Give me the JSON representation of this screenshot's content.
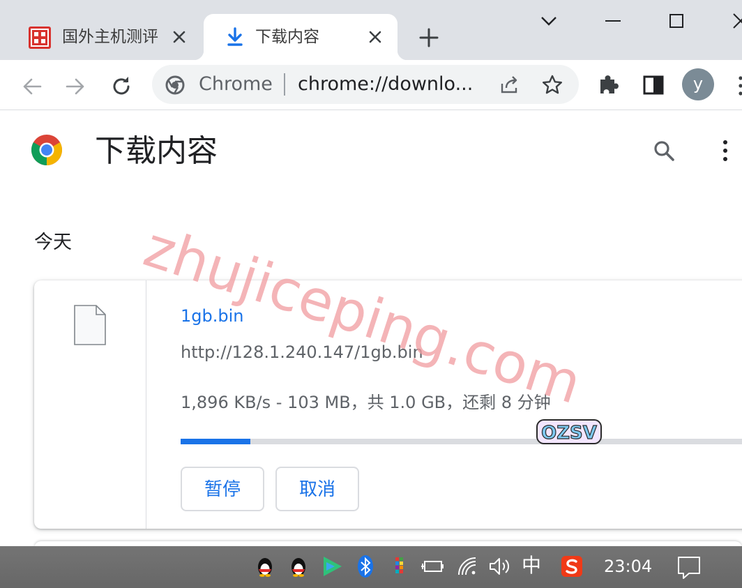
{
  "tabs": [
    {
      "title": "国外主机测评",
      "active": false
    },
    {
      "title": "下载内容",
      "active": true
    }
  ],
  "window_controls": [
    "chevron-down",
    "minimize",
    "maximize",
    "close"
  ],
  "toolbar": {
    "omnibox": {
      "scheme_label": "Chrome",
      "url": "chrome://downlo..."
    },
    "profile_initial": "y"
  },
  "page": {
    "title": "下载内容",
    "date_heading": "今天",
    "download": {
      "file_name": "1gb.bin",
      "url": "http://128.1.240.147/1gb.bin",
      "status": "1,896 KB/s - 103 MB，共 1.0 GB，还剩 8 分钟",
      "progress_fraction": 0.12,
      "pause_label": "暂停",
      "cancel_label": "取消"
    }
  },
  "overlay": {
    "watermark": "zhujiceping.com",
    "sticker_text": "OZSV"
  },
  "taskbar": {
    "ime_label": "中",
    "clock": "23:04"
  },
  "colors": {
    "accent": "#1a73e8",
    "tabstrip": "#dee1e6",
    "watermark": "#f2a0a4"
  }
}
